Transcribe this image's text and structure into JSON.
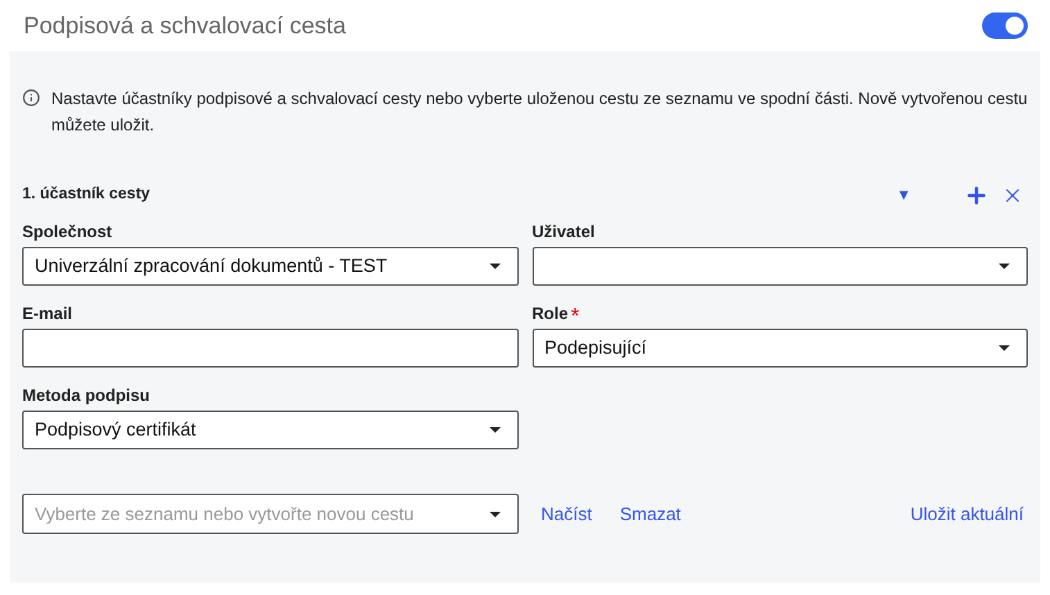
{
  "header": {
    "title": "Podpisová a schvalovací cesta",
    "toggle": {
      "on": true
    }
  },
  "info": "Nastavte účastníky podpisové a schvalovací cesty nebo vyberte uloženou cestu ze seznamu ve spodní části. Nově vytvořenou cestu můžete uložit.",
  "participant": {
    "title": "1. účastník cesty",
    "collapse_glyph": "▼",
    "fields": [
      {
        "label": "Společnost",
        "kind": "select",
        "value": "Univerzální zpracování dokumentů - TEST"
      },
      {
        "label": "Uživatel",
        "kind": "select"
      },
      {
        "label": "E-mail",
        "kind": "input"
      },
      {
        "label": "Role",
        "kind": "select",
        "value": "Podepisující",
        "required_mark": "*"
      },
      {
        "label": "Metoda podpisu",
        "kind": "select",
        "value": "Podpisový certifikát"
      }
    ]
  },
  "saved_route": {
    "placeholder": "Vyberte ze seznamu nebo vytvořte novou cestu",
    "actions": [
      "Načíst",
      "Smazat"
    ],
    "save": "Uložit aktuální"
  }
}
